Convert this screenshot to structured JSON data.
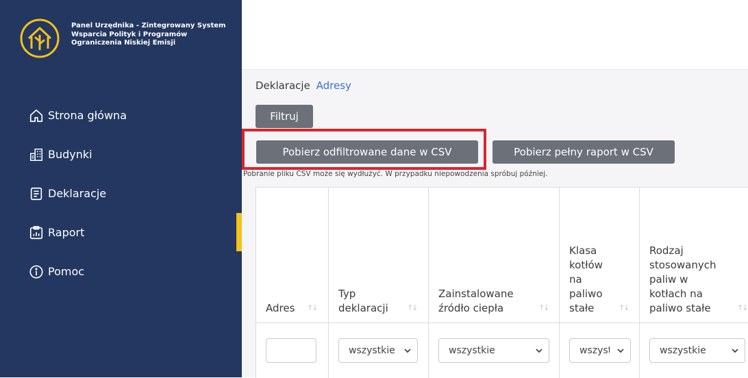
{
  "sidebar": {
    "brand_title": "Panel Urzędnika - Zintegrowany System Wsparcia Polityk i Programów Ograniczenia Niskiej Emisji",
    "items": [
      {
        "label": "Strona główna",
        "icon": "home-icon"
      },
      {
        "label": "Budynki",
        "icon": "building-icon"
      },
      {
        "label": "Deklaracje",
        "icon": "document-icon"
      },
      {
        "label": "Raport",
        "icon": "report-icon",
        "active": true
      },
      {
        "label": "Pomoc",
        "icon": "info-icon"
      }
    ]
  },
  "breadcrumb": {
    "current": "Deklaracje",
    "link": "Adresy"
  },
  "toolbar": {
    "filter_label": "Filtruj",
    "csv_filtered_label": "Pobierz odfiltrowane dane w CSV",
    "csv_full_label": "Pobierz pełny raport w CSV",
    "note": "Pobranie pliku CSV może się wydłużyć. W przypadku niepowodzenia spróbuj później."
  },
  "table": {
    "columns": [
      {
        "lines": [
          "Adres"
        ]
      },
      {
        "lines": [
          "Typ",
          "deklaracji"
        ]
      },
      {
        "lines": [
          "Zainstalowane",
          "źródło ciepła"
        ]
      },
      {
        "lines": [
          "Klasa",
          "kotłów",
          "na",
          "paliwo",
          "stałe"
        ]
      },
      {
        "lines": [
          "Rodzaj",
          "stosowanych",
          "paliw w",
          "kotłach na",
          "paliwo stałe"
        ]
      }
    ],
    "filters": [
      "",
      "wszystkie",
      "wszystkie",
      "wszystkie",
      "wszystkie"
    ]
  },
  "colors": {
    "sidebar_bg": "#233760",
    "accent": "#f5c11b",
    "button_bg": "#6c7179",
    "highlight": "#d8262c",
    "link": "#3a70c8"
  }
}
